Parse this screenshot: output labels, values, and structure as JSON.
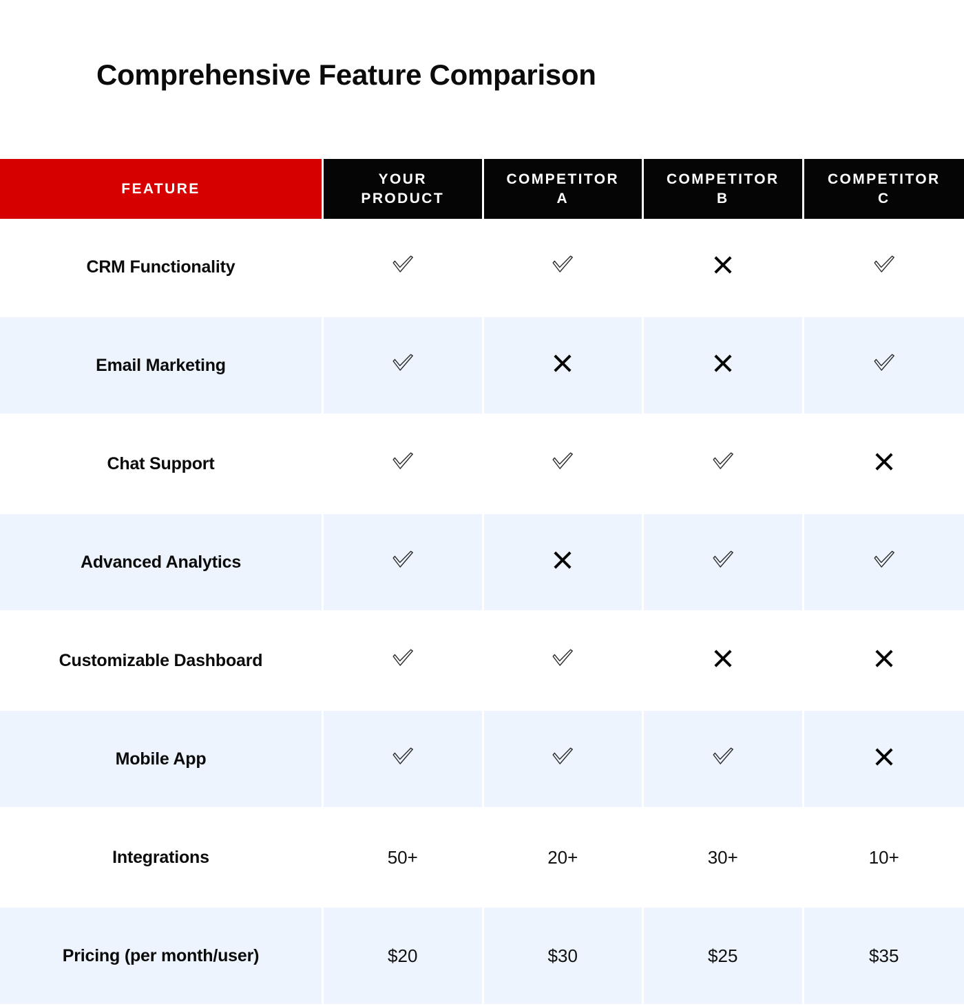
{
  "page": {
    "title": "Comprehensive Feature Comparison",
    "background": "#ffffff",
    "accent_red": "#D60000",
    "header_black": "#050505",
    "stripe_blue": "#EDF4FD"
  },
  "table": {
    "columns": [
      {
        "key": "feature",
        "label": "FEATURE",
        "style": "red"
      },
      {
        "key": "your_product",
        "label": "YOUR PRODUCT",
        "style": "black"
      },
      {
        "key": "competitor_a",
        "label": "COMPETITOR A",
        "style": "black"
      },
      {
        "key": "competitor_b",
        "label": "COMPETITOR B",
        "style": "black"
      },
      {
        "key": "competitor_c",
        "label": "COMPETITOR C",
        "style": "black"
      }
    ],
    "header_labels": {
      "feature": "FEATURE",
      "your_product_line1": "YOUR",
      "your_product_line2": "PRODUCT",
      "competitor_a_line1": "COMPETITOR",
      "competitor_a_line2": "A",
      "competitor_b_line1": "COMPETITOR",
      "competitor_b_line2": "B",
      "competitor_c_line1": "COMPETITOR",
      "competitor_c_line2": "C"
    },
    "icons": {
      "check": "check-outline-icon",
      "cross": "cross-icon"
    },
    "rows": [
      {
        "feature": "CRM Functionality",
        "cells": [
          {
            "type": "check",
            "value": "yes"
          },
          {
            "type": "check",
            "value": "yes"
          },
          {
            "type": "cross",
            "value": "no"
          },
          {
            "type": "check",
            "value": "yes"
          }
        ]
      },
      {
        "feature": "Email Marketing",
        "cells": [
          {
            "type": "check",
            "value": "yes"
          },
          {
            "type": "cross",
            "value": "no"
          },
          {
            "type": "cross",
            "value": "no"
          },
          {
            "type": "check",
            "value": "yes"
          }
        ]
      },
      {
        "feature": "Chat Support",
        "cells": [
          {
            "type": "check",
            "value": "yes"
          },
          {
            "type": "check",
            "value": "yes"
          },
          {
            "type": "check",
            "value": "yes"
          },
          {
            "type": "cross",
            "value": "no"
          }
        ]
      },
      {
        "feature": "Advanced Analytics",
        "cells": [
          {
            "type": "check",
            "value": "yes"
          },
          {
            "type": "cross",
            "value": "no"
          },
          {
            "type": "check",
            "value": "yes"
          },
          {
            "type": "check",
            "value": "yes"
          }
        ]
      },
      {
        "feature": "Customizable Dashboard",
        "cells": [
          {
            "type": "check",
            "value": "yes"
          },
          {
            "type": "check",
            "value": "yes"
          },
          {
            "type": "cross",
            "value": "no"
          },
          {
            "type": "cross",
            "value": "no"
          }
        ]
      },
      {
        "feature": "Mobile App",
        "cells": [
          {
            "type": "check",
            "value": "yes"
          },
          {
            "type": "check",
            "value": "yes"
          },
          {
            "type": "check",
            "value": "yes"
          },
          {
            "type": "cross",
            "value": "no"
          }
        ]
      },
      {
        "feature": "Integrations",
        "cells": [
          {
            "type": "text",
            "value": "50+"
          },
          {
            "type": "text",
            "value": "20+"
          },
          {
            "type": "text",
            "value": "30+"
          },
          {
            "type": "text",
            "value": "10+"
          }
        ]
      },
      {
        "feature": "Pricing (per month/user)",
        "cells": [
          {
            "type": "text",
            "value": "$20"
          },
          {
            "type": "text",
            "value": "$30"
          },
          {
            "type": "text",
            "value": "$25"
          },
          {
            "type": "text",
            "value": "$35"
          }
        ]
      }
    ]
  }
}
